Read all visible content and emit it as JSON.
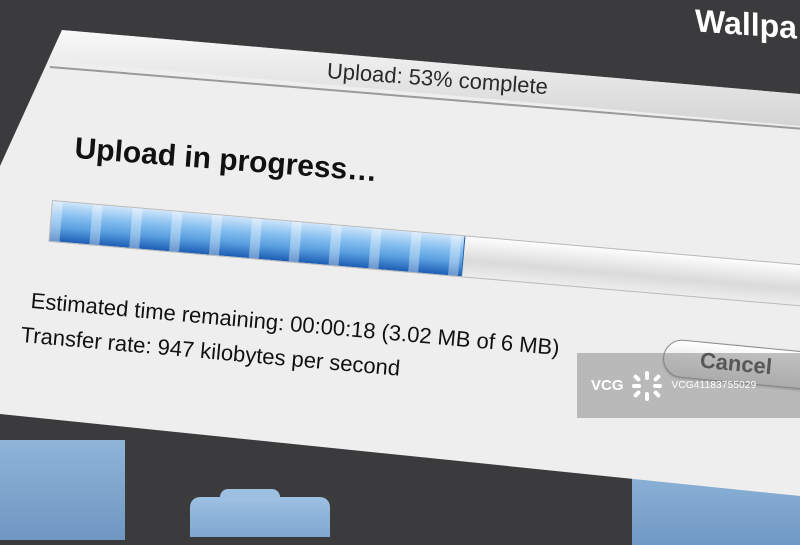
{
  "background": {
    "title": "Wallpa"
  },
  "dialog": {
    "title": "Upload: 53% complete",
    "heading": "Upload in progress…",
    "progress": {
      "fraction": 0.53,
      "fill_color": "#5a9fe0"
    },
    "eta_line": "Estimated time remaining: 00:00:18 (3.02 MB of 6 MB)",
    "rate_line": "Transfer rate: 947 kilobytes per second",
    "cancel_label": "Cancel"
  },
  "watermark": {
    "brand": "VCG",
    "code": "VCG41183755029"
  }
}
